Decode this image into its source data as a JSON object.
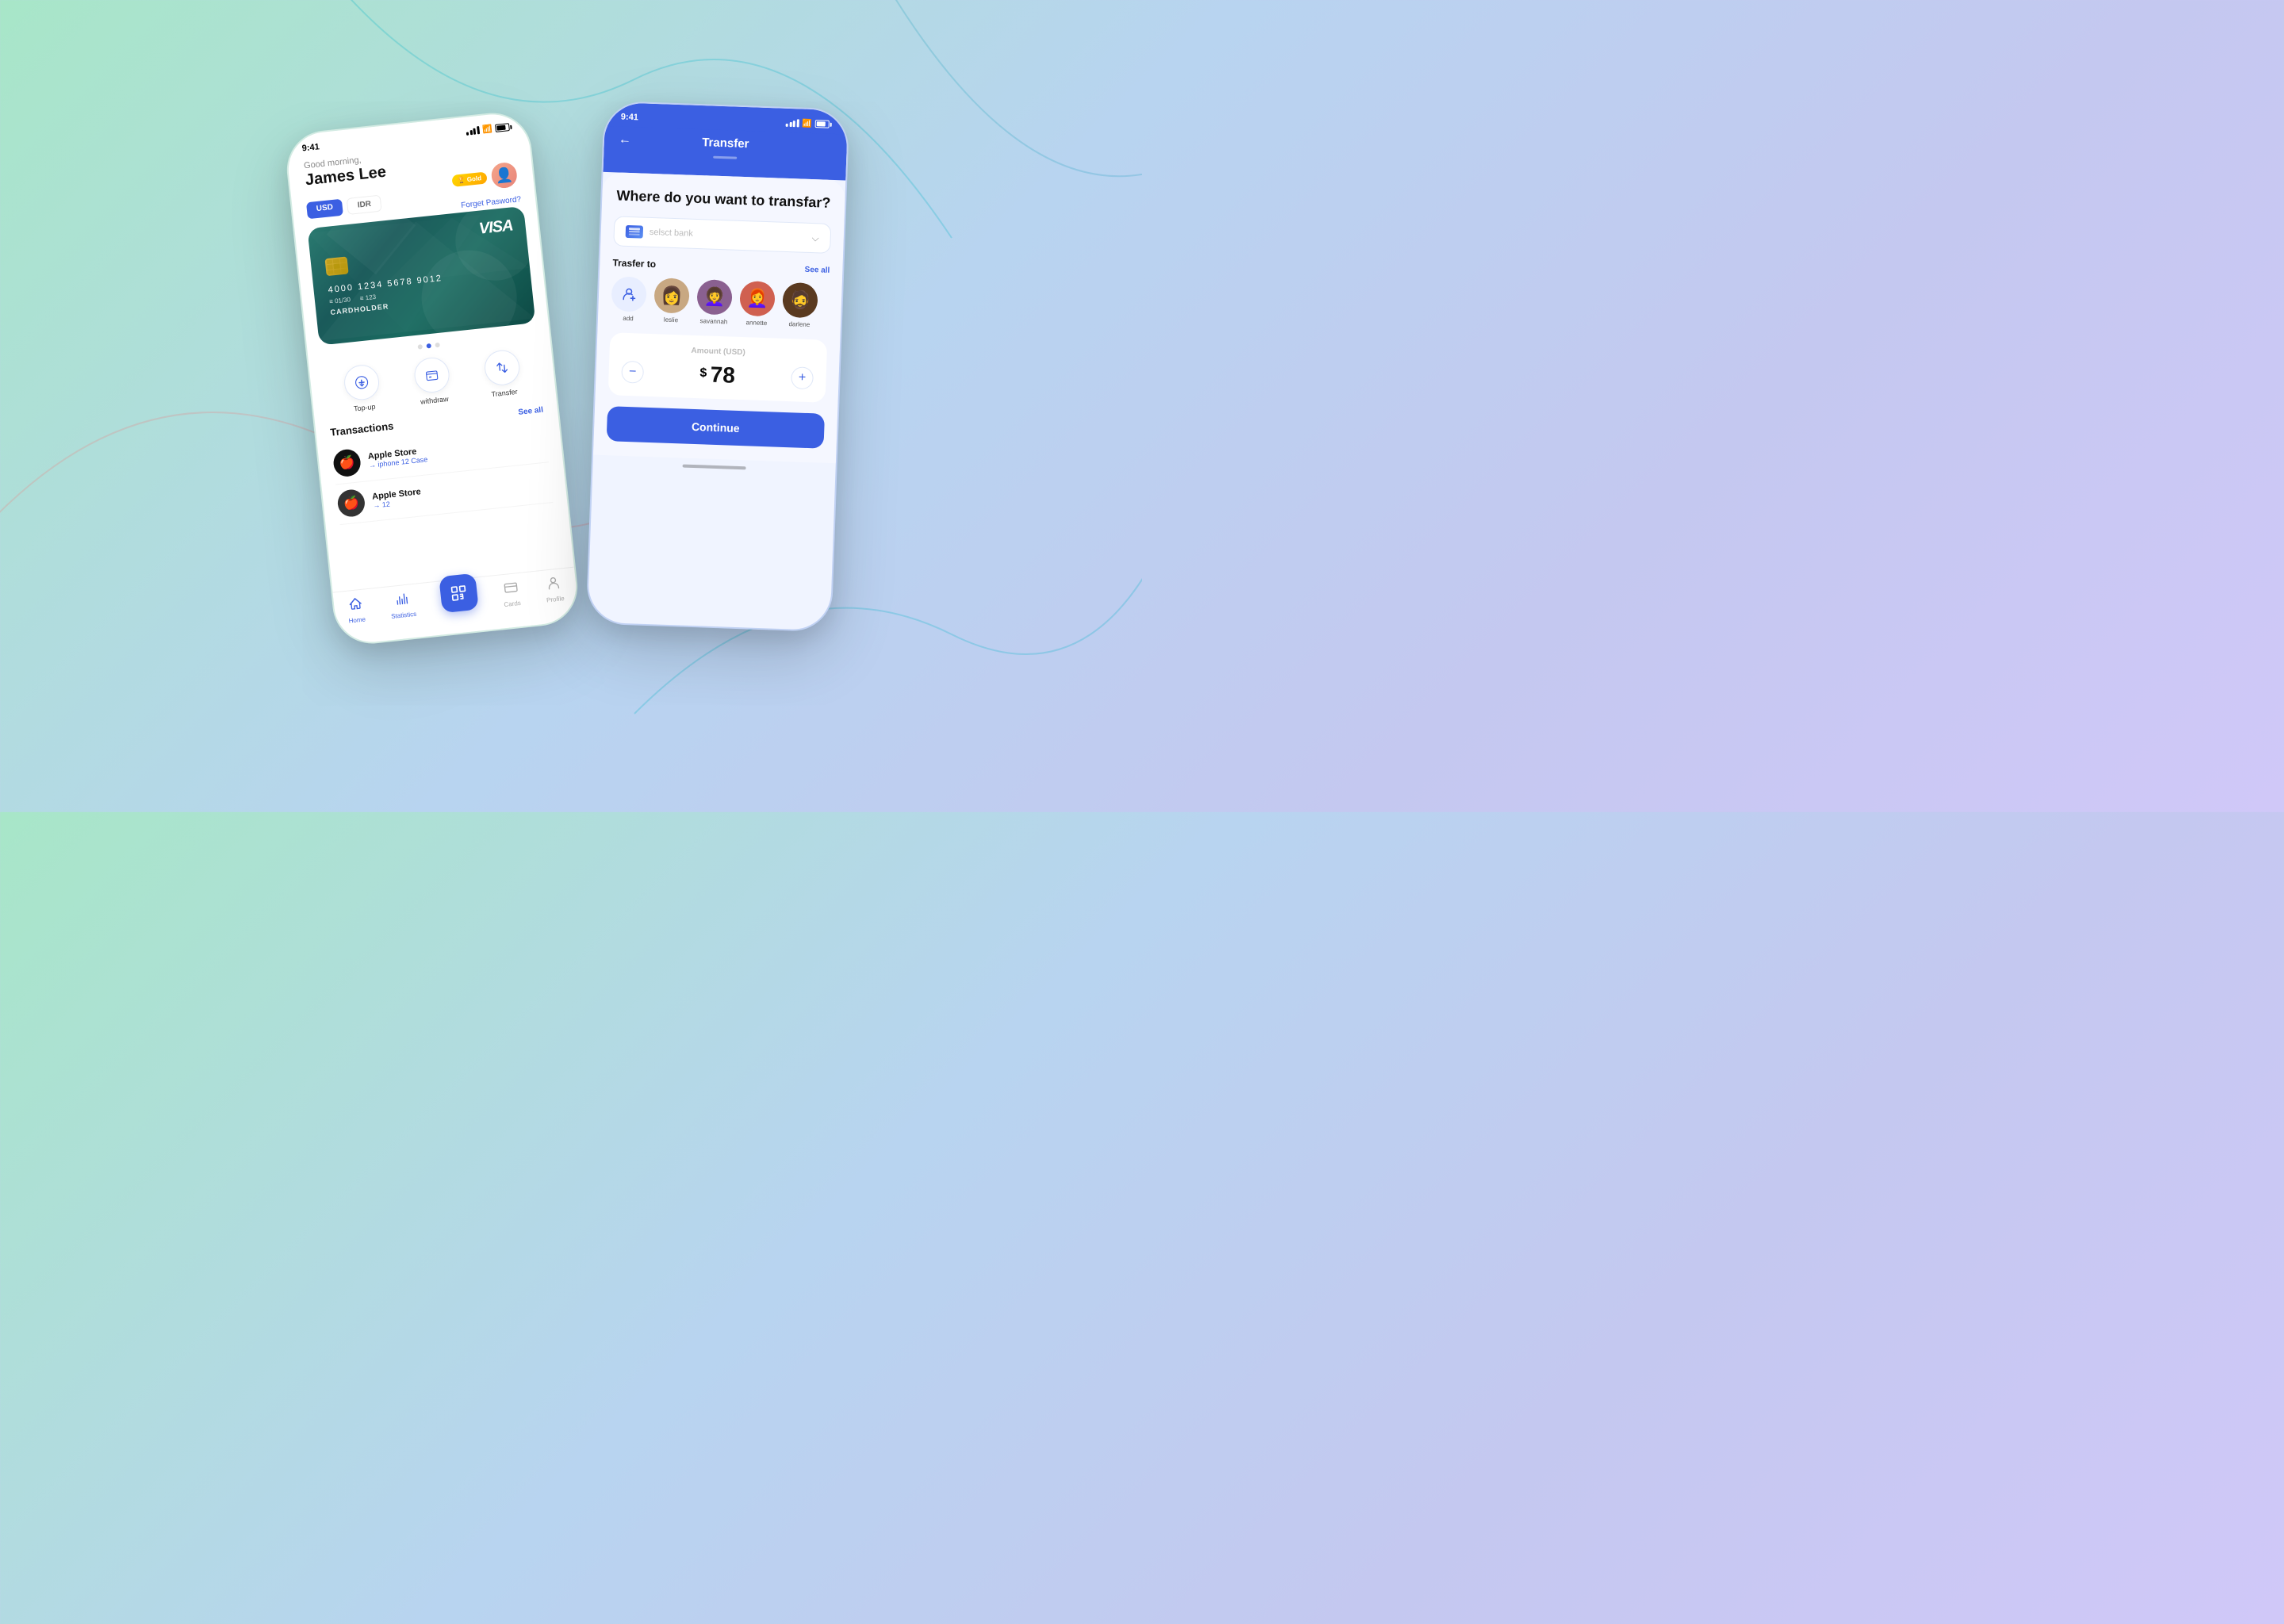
{
  "background": {
    "gradient_start": "#a8e6c8",
    "gradient_end": "#d0c8f8"
  },
  "phone1": {
    "status_bar": {
      "time": "9:41"
    },
    "header": {
      "greeting": "Good morning,",
      "username": "James Lee",
      "badge": "Gold",
      "forget_password": "Forget Pasword?"
    },
    "currency_tabs": [
      {
        "label": "USD",
        "active": true
      },
      {
        "label": "IDR",
        "active": false
      }
    ],
    "card": {
      "brand": "VISA",
      "number": "4000  1234  5678  9012",
      "expiry": "≡ 01/30",
      "cvv": "≡ 123",
      "cardholder": "CARDHOLDER"
    },
    "actions": [
      {
        "id": "topup",
        "label": "Top-up"
      },
      {
        "id": "withdraw",
        "label": "withdraw"
      },
      {
        "id": "transfer",
        "label": "Transfer"
      }
    ],
    "transactions": {
      "title": "Transactions",
      "see_all": "See all",
      "items": [
        {
          "name": "Apple Store",
          "desc": "→ iphone 12 Case"
        },
        {
          "name": "Apple Store",
          "desc": "→ 12"
        }
      ]
    },
    "bottom_nav": [
      {
        "id": "home",
        "label": "Home",
        "active": true
      },
      {
        "id": "statistics",
        "label": "Statistics",
        "active": false
      },
      {
        "id": "cards",
        "label": "Cards",
        "active": false
      },
      {
        "id": "profile",
        "label": "Profile",
        "active": false
      }
    ]
  },
  "phone2": {
    "status_bar": {
      "time": "9:41"
    },
    "header": {
      "back": "←",
      "title": "Transfer"
    },
    "body": {
      "question": "Where do you want to transfar?",
      "bank_select_placeholder": "selsct bank",
      "transfer_to_label": "Trasfer to",
      "see_all": "See all",
      "contacts": [
        {
          "name": "add",
          "type": "add"
        },
        {
          "name": "leslie",
          "type": "avatar",
          "color": "#c8a882"
        },
        {
          "name": "savannah",
          "type": "avatar",
          "color": "#8a6090"
        },
        {
          "name": "annette",
          "type": "avatar",
          "color": "#d06050"
        },
        {
          "name": "darlene",
          "type": "avatar",
          "color": "#5a3a20"
        }
      ],
      "amount_label": "Amount (USD)",
      "amount_currency": "$",
      "amount_value": "78",
      "minus_label": "−",
      "plus_label": "+",
      "continue_label": "Continue"
    }
  }
}
